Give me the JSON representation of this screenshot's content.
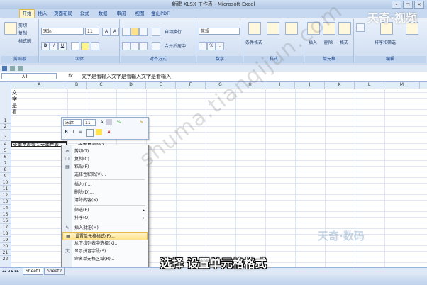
{
  "window": {
    "title": "新建 XLSX 工作表 - Microsoft Excel",
    "min": "–",
    "max": "□",
    "close": "×"
  },
  "tabs": [
    "开始",
    "插入",
    "页面布局",
    "公式",
    "数据",
    "审阅",
    "视图",
    "金山PDF"
  ],
  "ribbon": {
    "clipboard": {
      "label": "剪贴板",
      "cut": "剪切",
      "copy": "复制",
      "paste_format": "格式刷"
    },
    "font": {
      "label": "字体",
      "font_name": "宋体",
      "font_size": "11",
      "bold": "B",
      "italic": "I",
      "underline": "U",
      "grow": "A",
      "shrink": "A"
    },
    "alignment": {
      "label": "对齐方式",
      "wrap": "自动换行",
      "merge": "合并后居中"
    },
    "number": {
      "label": "数字",
      "format": "常规",
      "percent": "%",
      "comma": ","
    },
    "styles": {
      "label": "样式",
      "cond": "条件格式",
      "table": "套用表格格式",
      "cell": "单元格样式"
    },
    "cells": {
      "label": "单元格",
      "insert": "插入",
      "delete": "删除",
      "format": "格式"
    },
    "editing": {
      "label": "编辑",
      "sort": "排序和筛选",
      "find": "查找和选择"
    }
  },
  "formula_bar": {
    "name_box": "A4",
    "fx": "fx",
    "content": "文字是看输入文字是看输入文字是看输入"
  },
  "columns": [
    "A",
    "B",
    "C",
    "D",
    "E",
    "F",
    "G",
    "H",
    "I",
    "J",
    "K",
    "L",
    "M"
  ],
  "rows": [
    "1",
    "2",
    "3",
    "4",
    "5",
    "6",
    "7",
    "8",
    "9",
    "10",
    "11",
    "12",
    "13",
    "14",
    "15",
    "16",
    "17",
    "18",
    "19",
    "20",
    "21",
    "22"
  ],
  "cells": {
    "a1": "文字是看",
    "a4": "文字是看输入文字是看",
    "a4_overflow": "文字是看输入"
  },
  "mini_toolbar": {
    "font": "宋体",
    "size": "11",
    "bold": "B",
    "italic": "I",
    "align": "≡"
  },
  "context_menu": [
    {
      "label": "剪切(T)",
      "icon": "scissors-icon",
      "glyph": "✂"
    },
    {
      "label": "复制(C)",
      "icon": "copy-icon",
      "glyph": "❐"
    },
    {
      "label": "粘贴(P)",
      "icon": "paste-icon",
      "glyph": "▤"
    },
    {
      "label": "选择性粘贴(V)...",
      "icon": "",
      "glyph": ""
    },
    {
      "sep": true
    },
    {
      "label": "插入(I)...",
      "icon": "",
      "glyph": ""
    },
    {
      "label": "删除(D)...",
      "icon": "",
      "glyph": ""
    },
    {
      "label": "清除内容(N)",
      "icon": "",
      "glyph": ""
    },
    {
      "sep": true
    },
    {
      "label": "筛选(E)",
      "icon": "",
      "glyph": "",
      "arrow": "▸"
    },
    {
      "label": "排序(O)",
      "icon": "",
      "glyph": "",
      "arrow": "▸"
    },
    {
      "sep": true
    },
    {
      "label": "插入批注(M)",
      "icon": "comment-icon",
      "glyph": "✎"
    },
    {
      "label": "设置单元格格式(F)...",
      "icon": "format-cells-icon",
      "glyph": "▦",
      "highlight": true
    },
    {
      "label": "从下拉列表中选择(K)...",
      "icon": "",
      "glyph": ""
    },
    {
      "label": "显示拼音字段(S)",
      "icon": "pinyin-icon",
      "glyph": "文"
    },
    {
      "label": "命名单元格区域(R)...",
      "icon": "",
      "glyph": ""
    }
  ],
  "sheet_tabs": [
    "Sheet1",
    "Sheet2"
  ],
  "overlays": {
    "top_watermark": "天奇·视频",
    "diag_watermark": "shuma.tianqijun.com",
    "bottom_watermark": "天奇·数码",
    "subtitle": "选择 设置单元格格式"
  }
}
